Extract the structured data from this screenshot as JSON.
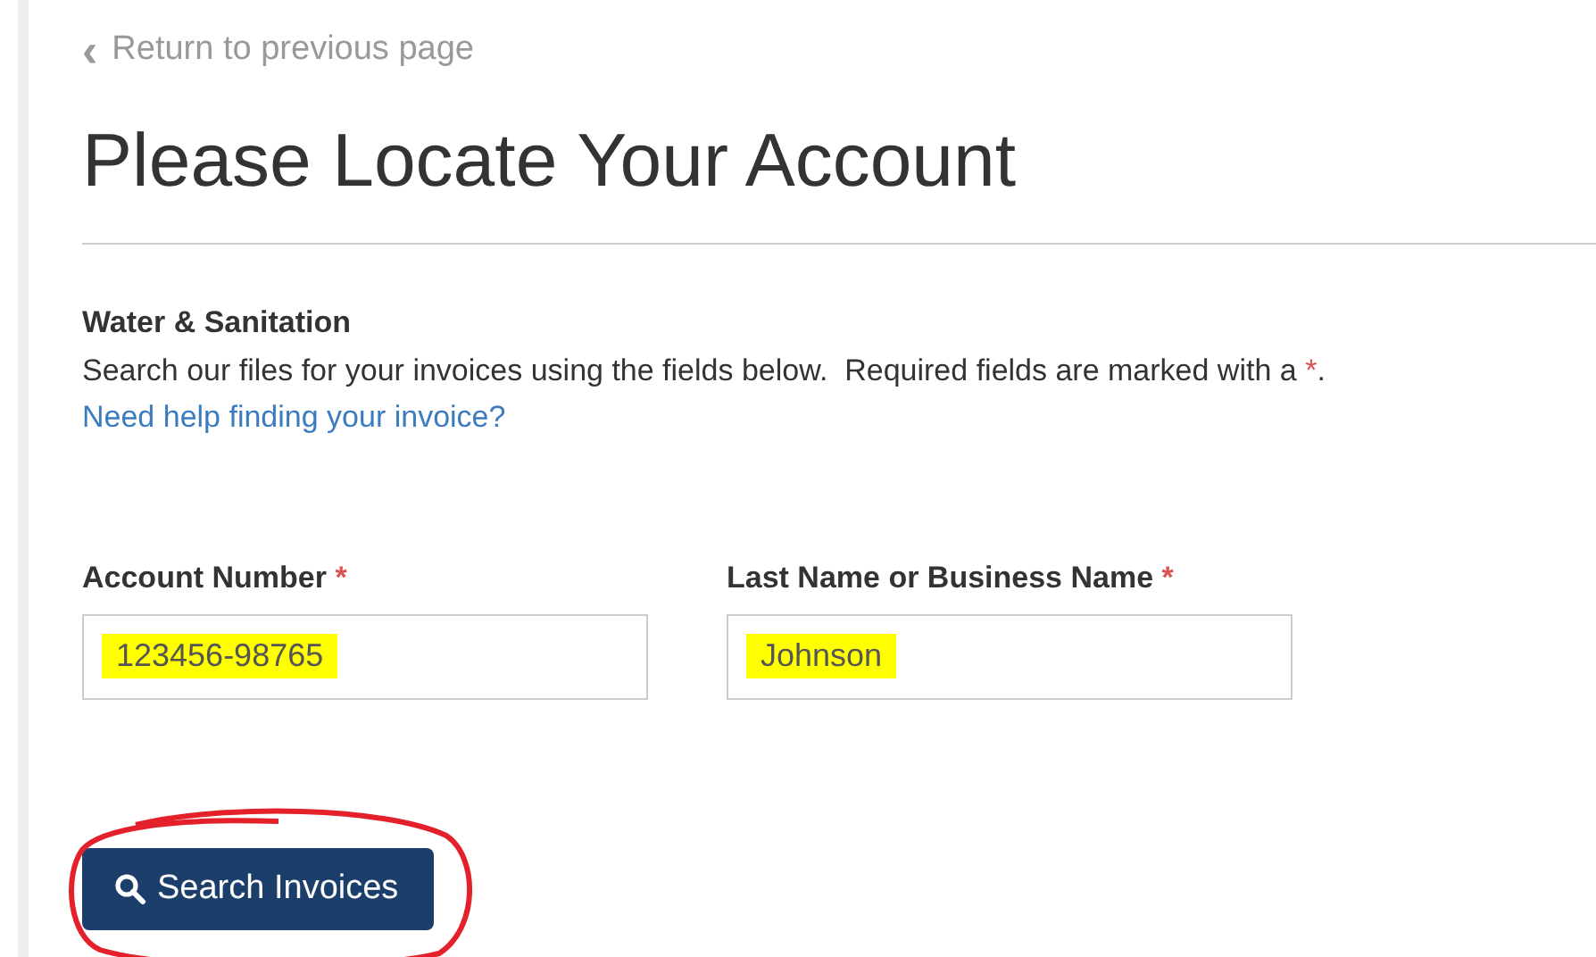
{
  "back_link": {
    "icon": "‹",
    "label": "Return to previous page"
  },
  "title": "Please Locate Your Account",
  "section": {
    "heading": "Water & Sanitation",
    "description": "Search our files for your invoices using the fields below.  Required fields are marked with a",
    "required_mark": "*",
    "description_end": ".",
    "help_link": "Need help finding your invoice?"
  },
  "fields": [
    {
      "label": "Account Number",
      "required": true,
      "value": "123456-98765",
      "highlighted": true
    },
    {
      "label": "Last Name or Business Name",
      "required": true,
      "value": "Johnson",
      "highlighted": true
    }
  ],
  "button": {
    "label": "Search Invoices",
    "circled": true
  }
}
